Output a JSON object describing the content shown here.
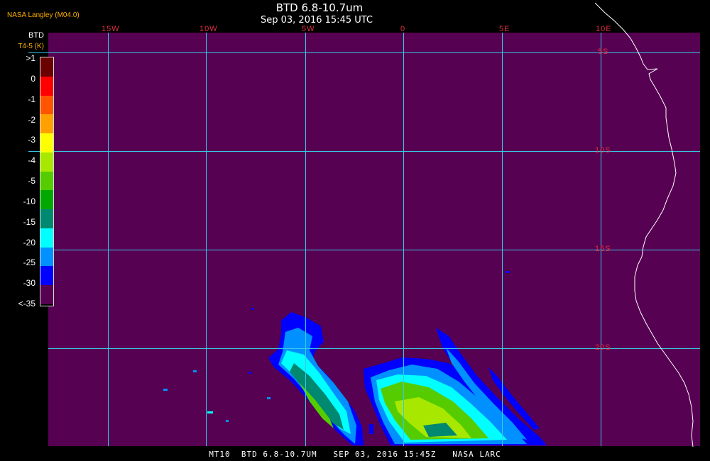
{
  "header": {
    "title": "BTD 6.8-10.7um",
    "timestamp": "Sep 03, 2016 15:45 UTC",
    "source": "NASA Langley (M04.0)"
  },
  "legend": {
    "title": "BTD",
    "subtitle": "T4-5 (K)",
    "ticks": [
      ">1",
      "0",
      "-1",
      "-2",
      "-3",
      "-4",
      "-5",
      "-10",
      "-15",
      "-20",
      "-25",
      "-30",
      "<-35"
    ],
    "colors": [
      "#6a0000",
      "#ff0000",
      "#ff5500",
      "#ffa000",
      "#ffff00",
      "#a8e800",
      "#55cc00",
      "#00a800",
      "#008870",
      "#00ffff",
      "#0090ff",
      "#0000ff",
      "#560152"
    ]
  },
  "map": {
    "background_color": "#560152",
    "grid_color": "#38c8e8",
    "longitude_labels": [
      "15W",
      "10W",
      "5W",
      "0",
      "5E",
      "10E"
    ],
    "latitude_labels": [
      "5S",
      "10S",
      "15S",
      "20S"
    ]
  },
  "footer": "MT10  BTD 6.8-10.7UM   SEP 03, 2016 15:45Z   NASA LARC"
}
